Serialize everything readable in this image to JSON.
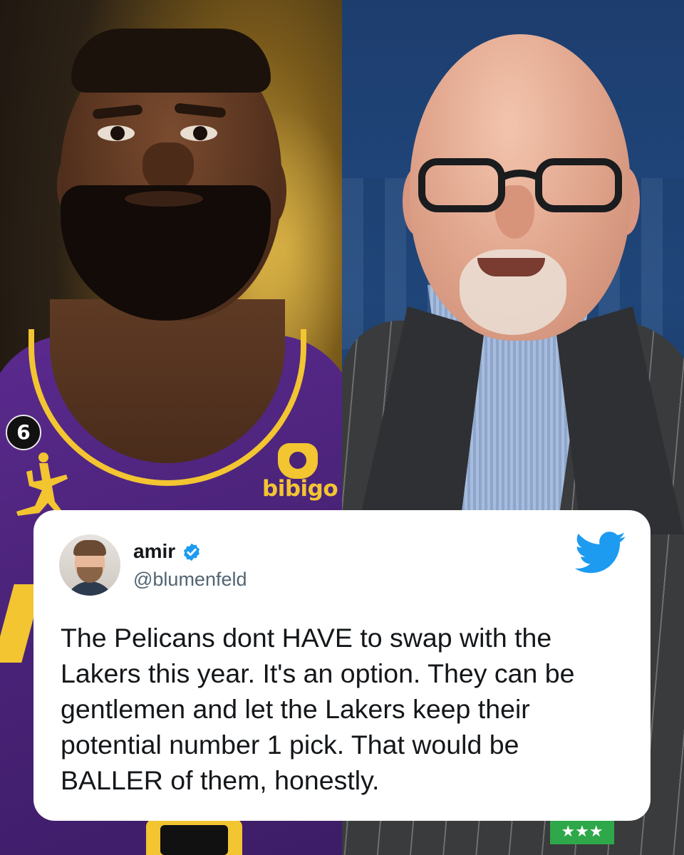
{
  "photos": {
    "left": {
      "jersey_number": "6",
      "sponsor": "bibigo",
      "colors": {
        "jersey": "#4a2378",
        "trim": "#f2c531"
      }
    },
    "right": {
      "badge_text": "★★★",
      "colors": {
        "background": "#1d3d6e",
        "suit": "#3a3b3d"
      }
    }
  },
  "tweet": {
    "display_name": "amir",
    "handle": "@blumenfeld",
    "verified": true,
    "text": "The Pelicans dont HAVE to swap with the\nLakers this year. It's an option. They can be\ngentlemen and let the Lakers keep their\npotential number 1 pick. That would be\nBALLER of them, honestly.",
    "icons": {
      "platform": "twitter-bird-icon",
      "verified": "verified-badge-icon"
    },
    "colors": {
      "card": "#ffffff",
      "text": "#14171a",
      "handle": "#536471",
      "accent": "#1d9bf0"
    }
  }
}
